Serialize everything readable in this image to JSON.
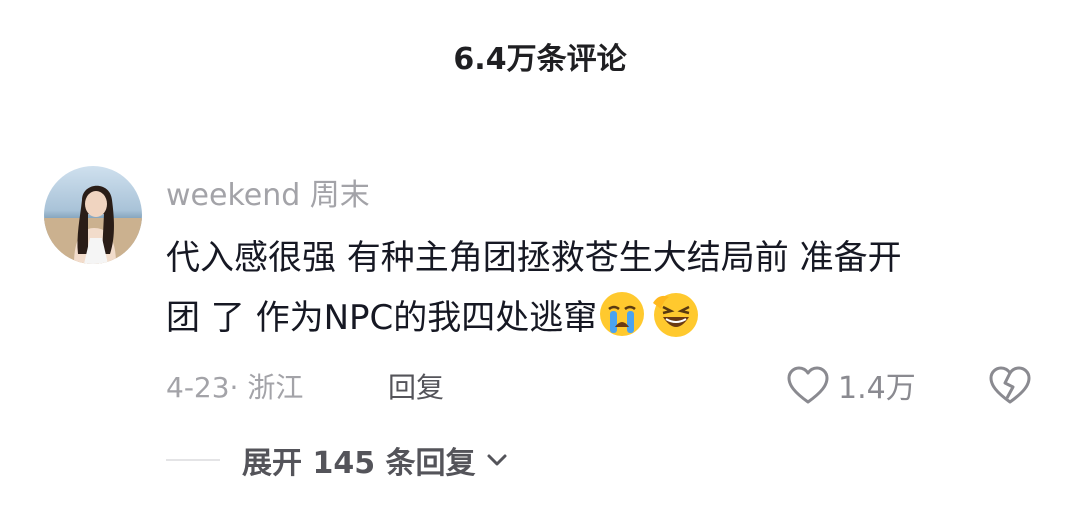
{
  "header": {
    "title": "6.4万条评论"
  },
  "comment": {
    "username": "weekend 周末",
    "text_line1": "代入感很强 有种主角团拯救苍生大结局前 准备开",
    "text_line2": "团 了 作为NPC的我四处逃窜",
    "emojis": [
      "crying-face-icon",
      "laughing-face-icon"
    ],
    "date_location": "4-23· 浙江",
    "reply_label": "回复",
    "like_count": "1.4万",
    "icons": {
      "like": "heart-outline-icon",
      "dislike": "broken-heart-icon"
    }
  },
  "replies": {
    "expand_label": "展开 145 条回复"
  },
  "colors": {
    "text_primary": "#161823",
    "text_secondary": "#a3a3a8",
    "emoji_yellow": "#ffc92e",
    "tear_blue": "#4aa3f0"
  }
}
